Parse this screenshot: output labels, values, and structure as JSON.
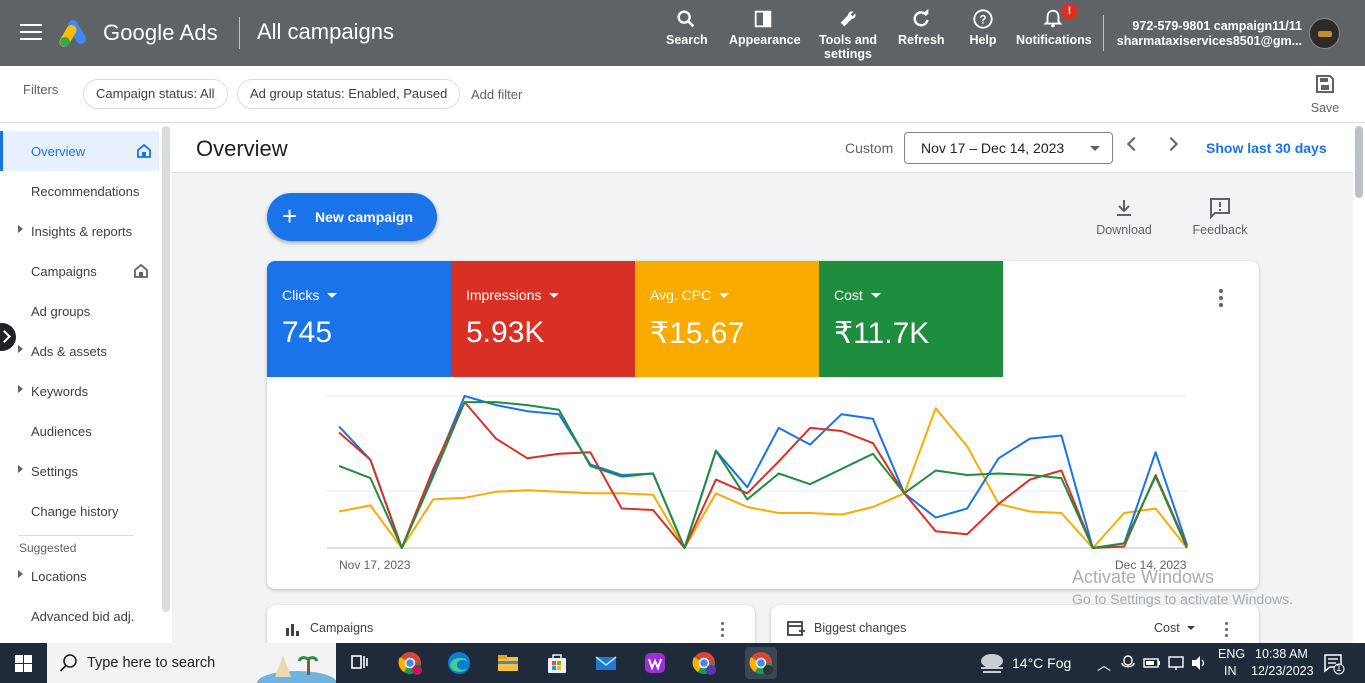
{
  "header": {
    "brand": "Google Ads",
    "page_title": "All campaigns",
    "buttons": [
      {
        "id": "search",
        "line1": "Search",
        "line2": "",
        "icon": "search-icon"
      },
      {
        "id": "appearance",
        "line1": "Appearance",
        "line2": "",
        "icon": "appearance-icon"
      },
      {
        "id": "tools",
        "line1": "Tools and",
        "line2": "settings",
        "icon": "wrench-icon"
      },
      {
        "id": "refresh",
        "line1": "Refresh",
        "line2": "",
        "icon": "refresh-icon"
      },
      {
        "id": "help",
        "line1": "Help",
        "line2": "",
        "icon": "help-icon"
      },
      {
        "id": "notifications",
        "line1": "Notifications",
        "line2": "",
        "icon": "bell-icon"
      }
    ],
    "notification_badge": "!",
    "account_line1": "972-579-9801 campaign11/11",
    "account_line2": "sharmataxiservices8501@gm..."
  },
  "filters": {
    "label": "Filters",
    "chips": [
      "Campaign status: All",
      "Ad group status: Enabled, Paused"
    ],
    "add_filter": "Add filter",
    "save_label": "Save"
  },
  "sidebar": {
    "items": [
      {
        "label": "Overview",
        "expandable": false,
        "home": true,
        "active": true
      },
      {
        "label": "Recommendations",
        "expandable": false,
        "home": false,
        "active": false
      },
      {
        "label": "Insights & reports",
        "expandable": true,
        "home": false,
        "active": false
      },
      {
        "label": "Campaigns",
        "expandable": false,
        "home": true,
        "active": false
      },
      {
        "label": "Ad groups",
        "expandable": false,
        "home": false,
        "active": false
      },
      {
        "label": "Ads & assets",
        "expandable": true,
        "home": false,
        "active": false
      },
      {
        "label": "Keywords",
        "expandable": true,
        "home": false,
        "active": false
      },
      {
        "label": "Audiences",
        "expandable": false,
        "home": false,
        "active": false
      },
      {
        "label": "Settings",
        "expandable": true,
        "home": false,
        "active": false
      },
      {
        "label": "Change history",
        "expandable": false,
        "home": false,
        "active": false
      }
    ],
    "suggested_label": "Suggested",
    "suggested_items": [
      {
        "label": "Locations",
        "expandable": true
      },
      {
        "label": "Advanced bid adj.",
        "expandable": false
      }
    ]
  },
  "overview": {
    "title": "Overview",
    "custom_label": "Custom",
    "date_range": "Nov 17 – Dec 14, 2023",
    "show_last": "Show last 30 days",
    "new_campaign": "New campaign",
    "download": "Download",
    "feedback": "Feedback",
    "metrics": [
      {
        "label": "Clicks",
        "value": "745",
        "color": "#1a73e8"
      },
      {
        "label": "Impressions",
        "value": "5.93K",
        "color": "#d93025"
      },
      {
        "label": "Avg. CPC",
        "value": "₹15.67",
        "color": "#f9ab00"
      },
      {
        "label": "Cost",
        "value": "₹11.7K",
        "color": "#1e8e3e"
      }
    ],
    "x_start": "Nov 17, 2023",
    "x_end": "Dec 14, 2023",
    "campaigns_card": "Campaigns",
    "biggest_changes_card": "Biggest changes",
    "biggest_changes_select": "Cost"
  },
  "chart_data": {
    "type": "line",
    "x": [
      "Nov 17, 2023",
      "Nov 18, 2023",
      "Nov 19, 2023",
      "Nov 20, 2023",
      "Nov 21, 2023",
      "Nov 22, 2023",
      "Nov 23, 2023",
      "Nov 24, 2023",
      "Nov 25, 2023",
      "Nov 26, 2023",
      "Nov 27, 2023",
      "Nov 28, 2023",
      "Nov 29, 2023",
      "Nov 30, 2023",
      "Dec 1, 2023",
      "Dec 2, 2023",
      "Dec 3, 2023",
      "Dec 4, 2023",
      "Dec 5, 2023",
      "Dec 6, 2023",
      "Dec 7, 2023",
      "Dec 8, 2023",
      "Dec 9, 2023",
      "Dec 10, 2023",
      "Dec 11, 2023",
      "Dec 12, 2023",
      "Dec 13, 2023",
      "Dec 14, 2023"
    ],
    "series": [
      {
        "name": "Clicks",
        "color": "#1a73e8",
        "values": [
          0.8,
          0.58,
          0.0,
          0.5,
          1.0,
          0.94,
          0.9,
          0.88,
          0.55,
          0.48,
          0.49,
          0.0,
          0.64,
          0.4,
          0.79,
          0.68,
          0.88,
          0.85,
          0.36,
          0.2,
          0.26,
          0.59,
          0.72,
          0.74,
          0.0,
          0.03,
          0.63,
          0.02
        ]
      },
      {
        "name": "Impressions",
        "color": "#d93025",
        "values": [
          0.76,
          0.58,
          0.0,
          0.52,
          0.96,
          0.72,
          0.59,
          0.62,
          0.63,
          0.26,
          0.25,
          0.0,
          0.45,
          0.36,
          0.57,
          0.79,
          0.77,
          0.69,
          0.36,
          0.11,
          0.09,
          0.29,
          0.45,
          0.51,
          0.0,
          0.01,
          0.48,
          0.01
        ]
      },
      {
        "name": "Avg. CPC",
        "color": "#f9ab00",
        "values": [
          0.24,
          0.28,
          0.0,
          0.32,
          0.33,
          0.37,
          0.38,
          0.37,
          0.36,
          0.36,
          0.35,
          0.0,
          0.36,
          0.27,
          0.23,
          0.23,
          0.22,
          0.27,
          0.36,
          0.92,
          0.67,
          0.29,
          0.24,
          0.23,
          0.0,
          0.23,
          0.26,
          0.0
        ]
      },
      {
        "name": "Cost",
        "color": "#1e8e3e",
        "values": [
          0.54,
          0.46,
          0.0,
          0.47,
          0.96,
          0.96,
          0.94,
          0.91,
          0.54,
          0.47,
          0.49,
          0.0,
          0.64,
          0.32,
          0.49,
          0.42,
          0.52,
          0.62,
          0.36,
          0.51,
          0.48,
          0.49,
          0.48,
          0.46,
          0.0,
          0.03,
          0.47,
          0.0
        ]
      }
    ]
  },
  "watermark": {
    "line1": "Activate Windows",
    "line2": "Go to Settings to activate Windows."
  },
  "taskbar": {
    "search_placeholder": "Type here to search",
    "weather": "14°C  Fog",
    "lang1": "ENG",
    "lang2": "IN",
    "time": "10:38 AM",
    "date": "12/23/2023",
    "notif_count": "1",
    "apps": [
      "task-view",
      "chrome-profile-a",
      "edge",
      "file-explorer",
      "microsoft-store",
      "mail",
      "wps-office",
      "chrome-profile-s",
      "chrome-active"
    ]
  }
}
